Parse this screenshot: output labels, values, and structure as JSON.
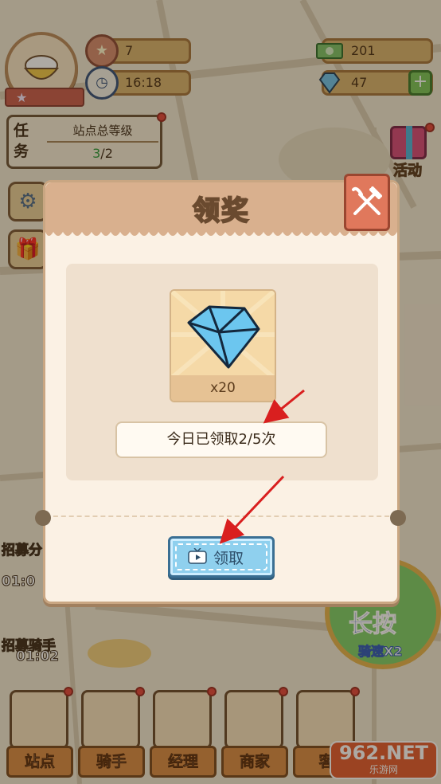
{
  "hud": {
    "level": "7",
    "time": "16:18",
    "cash": "201",
    "gems": "47",
    "task": {
      "label": "任务",
      "title": "站点总等级",
      "progress_current": "3",
      "progress_total": "/2"
    },
    "activity_label": "活动",
    "left_labels": [
      "招募分",
      "01:0",
      "招募骑手",
      "01:02"
    ],
    "long_press": {
      "line1": "长按",
      "line2": "骑速X2"
    }
  },
  "modal": {
    "title": "领奖",
    "reward_count": "x20",
    "claims_today": "今日已领取2/5次",
    "claim_button": "领取",
    "reward_icon": "diamond-icon",
    "close_icon": "fork-knife-icon"
  },
  "bottom_nav": [
    {
      "label": "站点"
    },
    {
      "label": "骑手"
    },
    {
      "label": "经理"
    },
    {
      "label": "商家"
    },
    {
      "label": "客"
    }
  ],
  "watermark": {
    "top": "962.NET",
    "bottom": "乐游网"
  },
  "colors": {
    "modal_bg": "#fbf1e4",
    "header": "#d9b08e",
    "claim_button": "#8fd0ee",
    "annotation_arrow": "#d91f1f"
  }
}
